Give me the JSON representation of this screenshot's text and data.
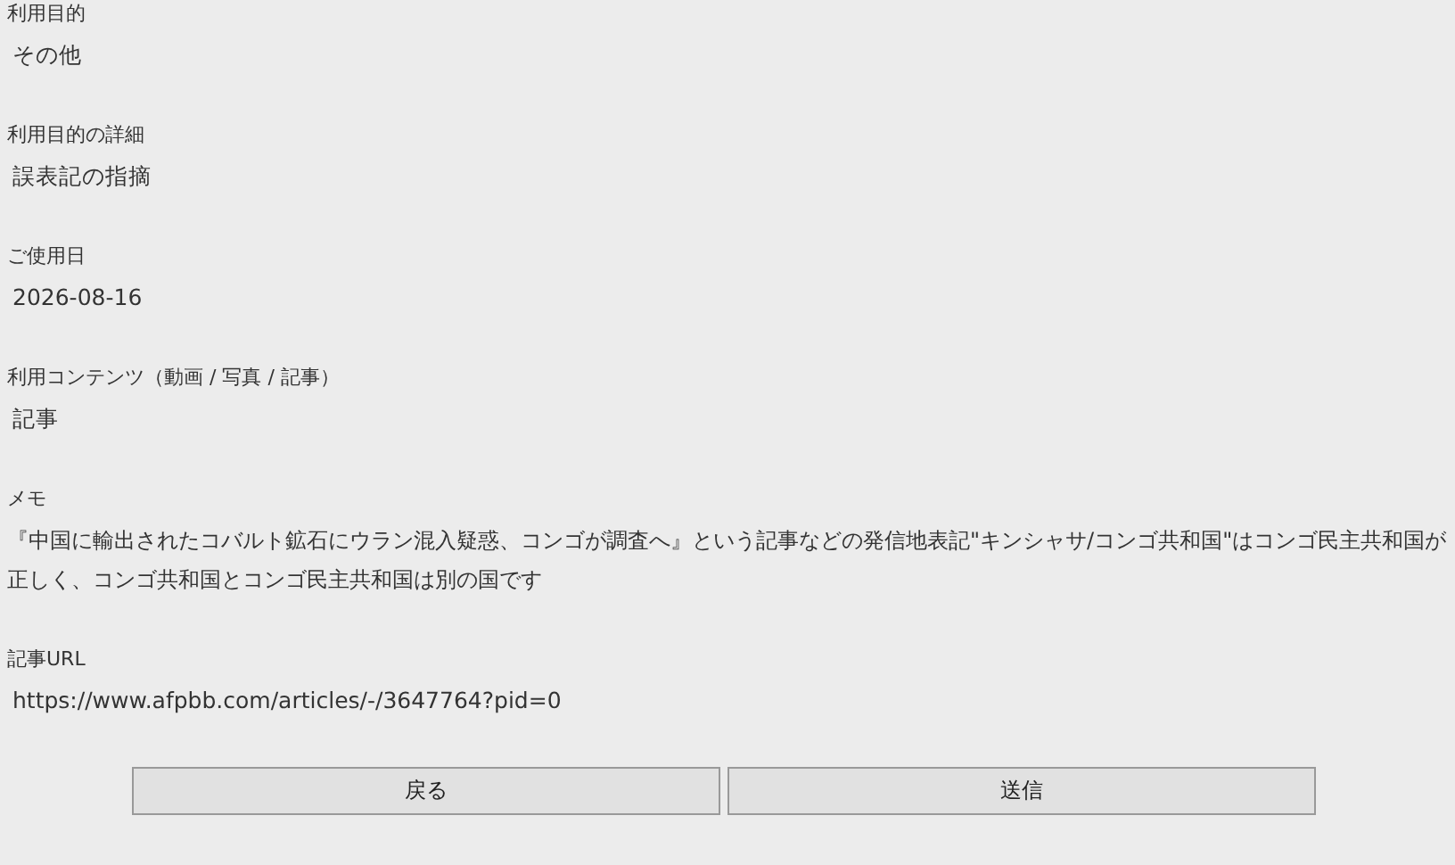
{
  "fields": [
    {
      "label": "利用目的",
      "value": "その他"
    },
    {
      "label": "利用目的の詳細",
      "value": "誤表記の指摘"
    },
    {
      "label": "ご使用日",
      "value": "2026-08-16"
    },
    {
      "label": "利用コンテンツ（動画 / 写真 / 記事）",
      "value": "記事"
    },
    {
      "label": "メモ",
      "value": "『中国に輸出されたコバルト鉱石にウラン混入疑惑、コンゴが調査へ』という記事などの発信地表記\"キンシャサ/コンゴ共和国\"はコンゴ民主共和国が正しく、コンゴ共和国とコンゴ民主共和国は別の国です"
    },
    {
      "label": "記事URL",
      "value": "https://www.afpbb.com/articles/-/3647764?pid=0"
    }
  ],
  "buttons": [
    "戻る",
    "送信"
  ]
}
